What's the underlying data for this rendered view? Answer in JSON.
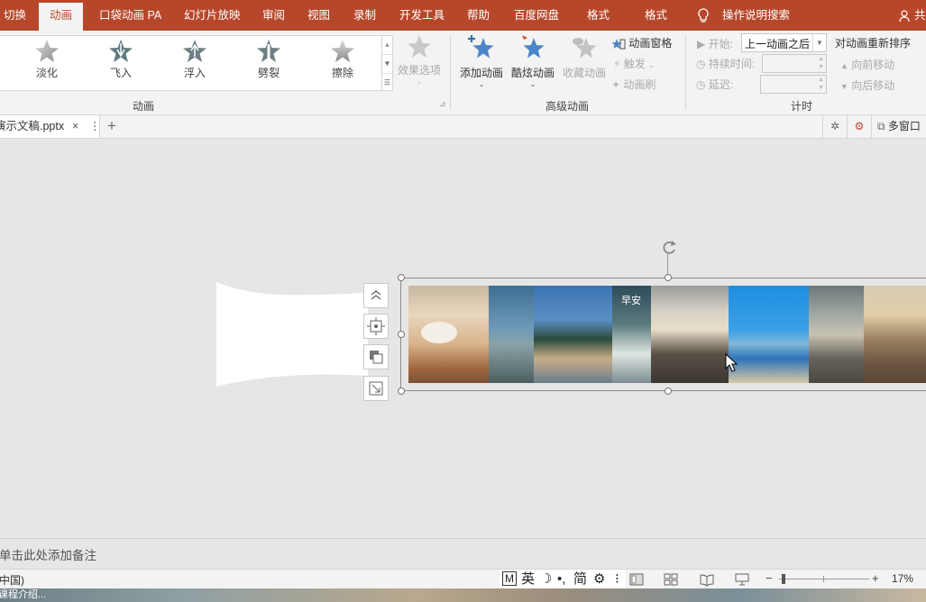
{
  "ribbon_tabs": {
    "switch": "切换",
    "animation": "动画",
    "pocket": "口袋动画 PA",
    "slideshow": "幻灯片放映",
    "review": "审阅",
    "view": "视图",
    "record": "录制",
    "developer": "开发工具",
    "help": "帮助",
    "baidu": "百度网盘",
    "format1": "格式",
    "format2": "格式",
    "search": "操作说明搜索",
    "share": "共"
  },
  "gallery": [
    "淡化",
    "飞入",
    "浮入",
    "劈裂",
    "擦除"
  ],
  "effect_options": "效果选项",
  "group_animation": "动画",
  "advanced": {
    "add_animation": "添加动画",
    "cool_animation": "酷炫动画",
    "collect_animation": "收藏动画",
    "animation_pane": "动画窗格",
    "trigger": "触发",
    "animation_painter": "动画刷",
    "group_label": "高级动画"
  },
  "timing": {
    "start_label": "开始:",
    "start_value": "上一动画之后",
    "duration_label": "持续时间:",
    "delay_label": "延迟:",
    "reorder_title": "对动画重新排序",
    "move_earlier": "向前移动",
    "move_later": "向后移动",
    "group_label": "计时"
  },
  "document_tab": {
    "filename": "演示文稿.pptx",
    "close": "×",
    "more": "⋮",
    "new_tab": "+"
  },
  "window": {
    "multi_window": "多窗口"
  },
  "notes_placeholder": "单击此处添加备注",
  "status": {
    "language": "中国)",
    "ime_items": [
      "M",
      "英",
      "☽",
      "•,",
      "简",
      "⚙",
      "⁝"
    ],
    "zoom_minus": "−",
    "zoom_plus": "+",
    "zoom": "17%"
  },
  "taskbar": {
    "text": "课程介绍..."
  },
  "colors": {
    "brand": "#b7472a",
    "accent_star": "#4a86c8"
  }
}
